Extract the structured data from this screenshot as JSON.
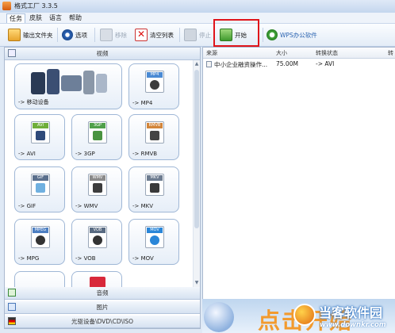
{
  "app": {
    "title": "格式工厂 3.3.5"
  },
  "menu": [
    {
      "label": "任务",
      "active": true
    },
    {
      "label": "皮肤",
      "active": false
    },
    {
      "label": "语言",
      "active": false
    },
    {
      "label": "帮助",
      "active": false
    }
  ],
  "toolbar": {
    "output_folder": "输出文件夹",
    "options": "选项",
    "remove": "移除",
    "clear_list": "清空列表",
    "stop": "停止",
    "start": "开始",
    "wps": "WPS办公软件"
  },
  "sections": {
    "video": "视频",
    "audio": "音频",
    "image": "图片",
    "rom": "光驱设备\\DVD\\CD\\ISO"
  },
  "video_tiles": [
    {
      "label": "-> 移动设备",
      "icon": "mobile-devices-icon"
    },
    {
      "label": "-> MP4",
      "tag": "MP4",
      "icon": "mp4-file-icon",
      "color": "#4a8ad4"
    },
    {
      "label": "-> AVI",
      "tag": "AVI",
      "icon": "avi-file-icon",
      "color": "#6fae3a"
    },
    {
      "label": "-> 3GP",
      "tag": "3GP",
      "icon": "3gp-file-icon",
      "color": "#4fa04a"
    },
    {
      "label": "-> RMVB",
      "tag": "RMVB",
      "icon": "rmvb-file-icon",
      "color": "#d2853a"
    },
    {
      "label": "-> GIF",
      "tag": "GIF",
      "icon": "gif-file-icon",
      "color": "#5a6f8c"
    },
    {
      "label": "-> WMV",
      "tag": "WMV",
      "icon": "wmv-file-icon",
      "color": "#8a8a8a"
    },
    {
      "label": "-> MKV",
      "tag": "MKV",
      "icon": "mkv-file-icon",
      "color": "#6d7c90"
    },
    {
      "label": "-> MPG",
      "tag": "MPEG",
      "icon": "mpg-file-icon",
      "color": "#4d7fc2"
    },
    {
      "label": "-> VOB",
      "tag": "VOB",
      "icon": "vob-file-icon",
      "color": "#596b82"
    },
    {
      "label": "-> MOV",
      "tag": "MOV",
      "icon": "mov-file-icon",
      "color": "#2a86d8"
    }
  ],
  "task_list": {
    "columns": {
      "source": "来源",
      "size": "大小",
      "status": "转换状态",
      "extra": "转"
    },
    "rows": [
      {
        "source": "中小企业融资操作...",
        "size": "75.00M",
        "status": "-> AVI"
      }
    ]
  },
  "ad": {
    "text": "点击开始"
  },
  "watermark": {
    "name": "当客软件园",
    "url": "www.downkr.com"
  }
}
